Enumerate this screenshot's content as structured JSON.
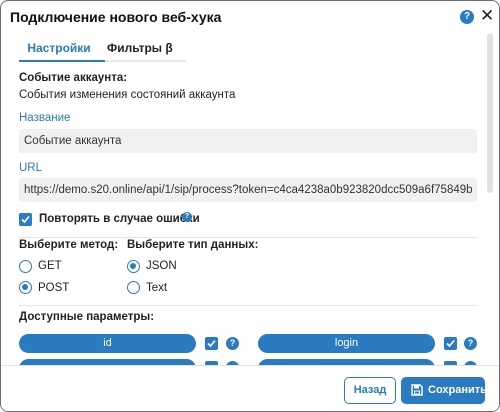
{
  "dialog": {
    "title": "Подключение нового веб-хука",
    "help_symbol": "?",
    "close_symbol": "✕"
  },
  "tabs": [
    {
      "label": "Настройки",
      "active": true
    },
    {
      "label": "Фильтры β",
      "active": false
    }
  ],
  "account_event": {
    "heading": "Событие аккаунта:",
    "description": "События изменения состояний аккаунта"
  },
  "name_field": {
    "label": "Название",
    "value": "Событие аккаунта"
  },
  "url_field": {
    "label": "URL",
    "value": "https://demo.s20.online/api/1/sip/process?token=c4ca4238a0b923820dcc509a6f75849b"
  },
  "retry": {
    "label": "Повторять в случае ошибки",
    "checked": true,
    "help_symbol": "?"
  },
  "method": {
    "label": "Выберите метод:",
    "options": [
      {
        "label": "GET",
        "checked": false
      },
      {
        "label": "POST",
        "checked": true
      }
    ]
  },
  "data_type": {
    "label": "Выберите тип данных:",
    "options": [
      {
        "label": "JSON",
        "checked": true
      },
      {
        "label": "Text",
        "checked": false
      }
    ]
  },
  "params": {
    "heading": "Доступные параметры:",
    "items": [
      {
        "label": "id",
        "checked": true,
        "help_symbol": "?"
      },
      {
        "label": "login",
        "checked": true,
        "help_symbol": "?"
      }
    ]
  },
  "footer": {
    "back_label": "Назад",
    "save_label": "Сохранить"
  },
  "colors": {
    "accent": "#2a7bbf",
    "field_bg": "#f1f1f1"
  },
  "icons": [
    "help-icon",
    "close-icon",
    "checkmark-icon",
    "save-icon"
  ]
}
